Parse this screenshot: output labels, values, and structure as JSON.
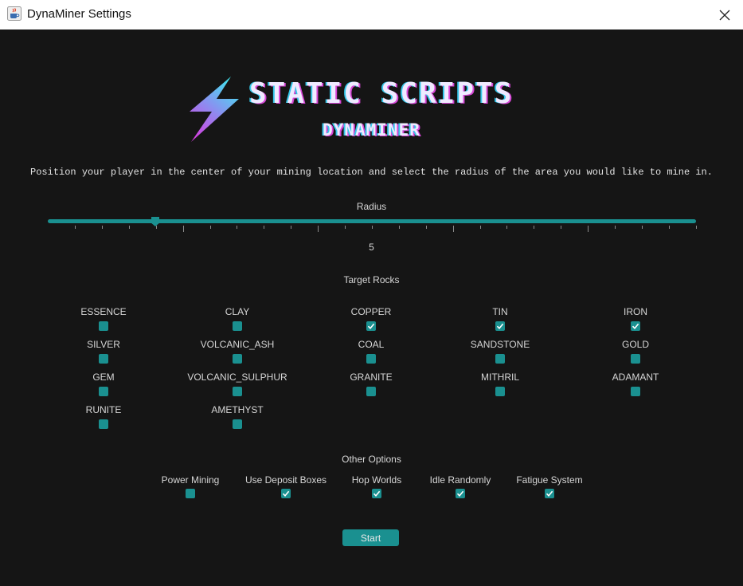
{
  "window": {
    "title": "DynaMiner Settings",
    "icon": "java-coffee-icon",
    "close_icon": "close-icon"
  },
  "logo": {
    "brand": "STATIC SCRIPTS",
    "product": "DYNAMINER",
    "icon": "lightning-bolt-icon",
    "colors": {
      "bolt_top": "#3ee8f0",
      "bolt_bottom": "#d43fe0",
      "text": "#f0eaff"
    }
  },
  "instruction": "Position your player in the center of your mining location and select the radius of the area you would like to mine in.",
  "radius": {
    "label": "Radius",
    "value": "5",
    "accent": "#1a9090"
  },
  "target_rocks": {
    "heading": "Target Rocks",
    "items": [
      {
        "label": "ESSENCE",
        "checked": false
      },
      {
        "label": "CLAY",
        "checked": false
      },
      {
        "label": "COPPER",
        "checked": true
      },
      {
        "label": "TIN",
        "checked": true
      },
      {
        "label": "IRON",
        "checked": true
      },
      {
        "label": "SILVER",
        "checked": false
      },
      {
        "label": "VOLCANIC_ASH",
        "checked": false
      },
      {
        "label": "COAL",
        "checked": false
      },
      {
        "label": "SANDSTONE",
        "checked": false
      },
      {
        "label": "GOLD",
        "checked": false
      },
      {
        "label": "GEM",
        "checked": false
      },
      {
        "label": "VOLCANIC_SULPHUR",
        "checked": false
      },
      {
        "label": "GRANITE",
        "checked": false
      },
      {
        "label": "MITHRIL",
        "checked": false
      },
      {
        "label": "ADAMANT",
        "checked": false
      },
      {
        "label": "RUNITE",
        "checked": false
      },
      {
        "label": "AMETHYST",
        "checked": false
      }
    ]
  },
  "other_options": {
    "heading": "Other Options",
    "items": [
      {
        "label": "Power Mining",
        "checked": false
      },
      {
        "label": "Use Deposit Boxes",
        "checked": true
      },
      {
        "label": "Hop Worlds",
        "checked": true
      },
      {
        "label": "Idle Randomly",
        "checked": true
      },
      {
        "label": "Fatigue System",
        "checked": true
      }
    ]
  },
  "start_button": {
    "label": "Start"
  },
  "colors": {
    "background": "#151515",
    "accent": "#1a9090",
    "text": "#d6d6d6"
  }
}
